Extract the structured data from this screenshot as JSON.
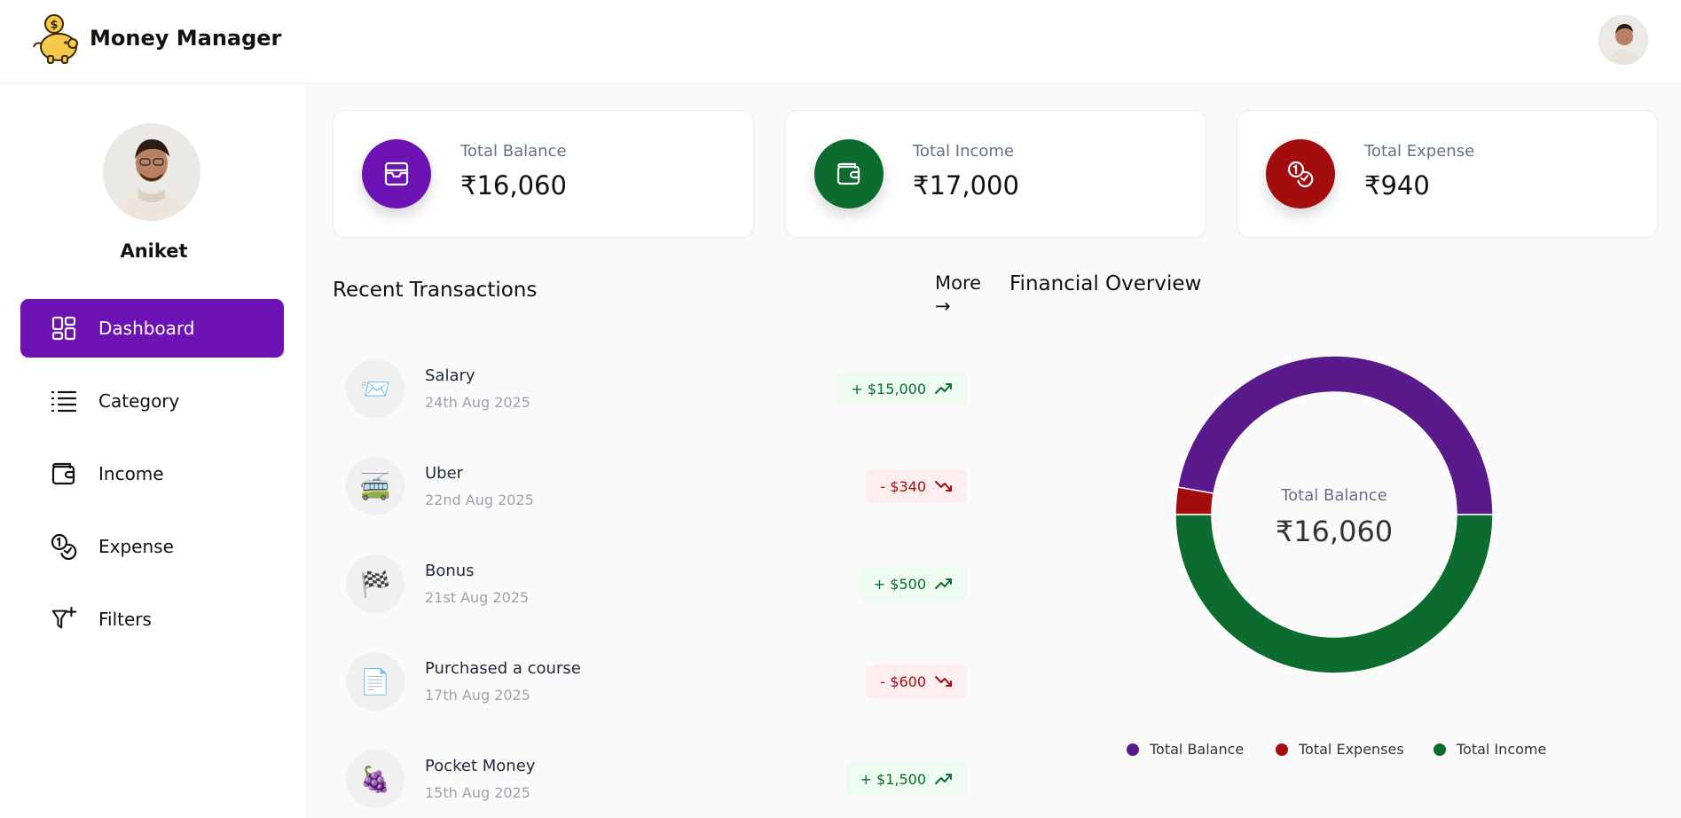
{
  "app": {
    "title": "Money Manager"
  },
  "user": {
    "name": "Aniket"
  },
  "sidebar": {
    "items": [
      {
        "label": "Dashboard",
        "icon": "dashboard-icon",
        "active": true
      },
      {
        "label": "Category",
        "icon": "list-icon",
        "active": false
      },
      {
        "label": "Income",
        "icon": "wallet-icon",
        "active": false
      },
      {
        "label": "Expense",
        "icon": "coins-icon",
        "active": false
      },
      {
        "label": "Filters",
        "icon": "filter-icon",
        "active": false
      }
    ]
  },
  "cards": [
    {
      "label": "Total Balance",
      "value": "₹16,060",
      "color": "#6d12b5",
      "icon": "wallet-card-icon"
    },
    {
      "label": "Total Income",
      "value": "₹17,000",
      "color": "#0c6b2e",
      "icon": "wallet-icon"
    },
    {
      "label": "Total Expense",
      "value": "₹940",
      "color": "#a40d0d",
      "icon": "coins-icon"
    }
  ],
  "recent": {
    "title": "Recent Transactions",
    "more_label": "More",
    "more_arrow": "→",
    "items": [
      {
        "name": "Salary",
        "date": "24th Aug 2025",
        "amount": "+ $15,000",
        "type": "income",
        "emoji": "📨"
      },
      {
        "name": "Uber",
        "date": "22nd Aug 2025",
        "amount": "- $340",
        "type": "expense",
        "emoji": "🚎"
      },
      {
        "name": "Bonus",
        "date": "21st Aug 2025",
        "amount": "+ $500",
        "type": "income",
        "emoji": "🏁"
      },
      {
        "name": "Purchased a course",
        "date": "17th Aug 2025",
        "amount": "- $600",
        "type": "expense",
        "emoji": "📄"
      },
      {
        "name": "Pocket Money",
        "date": "15th Aug 2025",
        "amount": "+ $1,500",
        "type": "income",
        "emoji": "🍇"
      }
    ]
  },
  "overview": {
    "title": "Financial Overview",
    "center_label": "Total Balance",
    "center_value": "₹16,060"
  },
  "chart_data": {
    "type": "pie",
    "donut": true,
    "categories": [
      "Total Balance",
      "Total Expenses",
      "Total Income"
    ],
    "values": [
      16060,
      940,
      17000
    ],
    "colors": [
      "#5a1a8c",
      "#a40d0d",
      "#0c6b2e"
    ],
    "legend": "bottom"
  },
  "colors": {
    "accent": "#6d12b5",
    "income": "#0c6b2e",
    "expense": "#a40d0d"
  }
}
